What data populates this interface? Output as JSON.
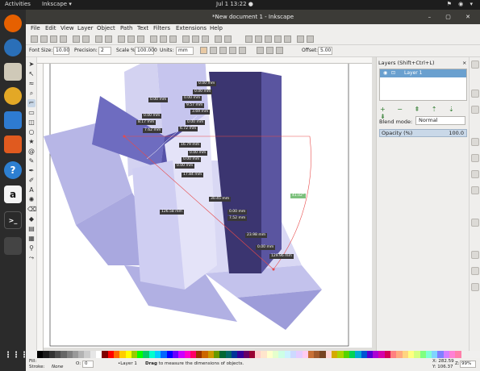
{
  "topbar": {
    "activities": "Activities",
    "app_name": "Inkscape ▾",
    "clock": "Jul 1  13:22 ●",
    "tray": "⚑ ◉ ▾"
  },
  "window": {
    "title": "*New document 1 - Inkscape",
    "controls": "– ▢ ✕"
  },
  "menu": [
    "File",
    "Edit",
    "View",
    "Layer",
    "Object",
    "Path",
    "Text",
    "Filters",
    "Extensions",
    "Help"
  ],
  "controls_bar": {
    "font_size_label": "Font Size:",
    "font_size_value": "10.00",
    "precision_label": "Precision:",
    "precision_value": "2",
    "scale_label": "Scale %:",
    "scale_value": "100.000",
    "units_label": "Units:",
    "units_value": "mm",
    "offset_label": "Offset:",
    "offset_value": "5.00"
  },
  "layers_panel": {
    "title": "Layers (Shift+Ctrl+L)",
    "close": "×",
    "layer_name": "Layer 1",
    "eye": "◉",
    "lock": "⊡",
    "buttons": "+ − ⇞ ⇡ ⇣ ⇟",
    "blend_label": "Blend mode:",
    "blend_value": "Normal",
    "opacity_label": "Opacity (%)",
    "opacity_value": "100.0"
  },
  "measurements": [
    "0.00 mm",
    "0.00 mm",
    "0.00 mm",
    "0.00 mm",
    "9.57 mm",
    "3.69 mm",
    "0.00 mm",
    "8.17 mm",
    "0.00 mm",
    "7.62 mm",
    "6.72 mm",
    "16.79 mm",
    "0.00 mm",
    "0.00 mm",
    "0.00 mm",
    "17.84 mm",
    "30.45 mm",
    "0.00 mm",
    "126.58 mm",
    "7.52 mm",
    "23.98 mm",
    "0.00 mm",
    "129.96 mm"
  ],
  "angle_label": "41.02°",
  "statusbar": {
    "fill_label": "Fill:",
    "stroke_label": "Stroke:",
    "stroke_value": "None",
    "opacity_label": "O:",
    "opacity_value": "0",
    "layer": "•Layer 1",
    "message_bold": "Drag",
    "message": " to measure the dimensions of objects.",
    "x": "X:  282.59",
    "y": "Y:  106.37",
    "zoom_label": "Z:",
    "zoom_value": "99%"
  },
  "colors": {
    "canvas_shape_dark": "#3b3570",
    "canvas_shape_mid": "#6e6cc0",
    "canvas_shape_light": "#b7b6e6",
    "measure_line": "#e84a4a",
    "selection_blue": "#6aa0cf"
  },
  "icons": {
    "dock": [
      "firefox-icon",
      "thunderbird-icon",
      "files-icon",
      "rhythmbox-icon",
      "writer-icon",
      "software-icon",
      "help-icon",
      "amazon-icon",
      "terminal-icon",
      "inkscape-icon",
      "apps-grid-icon"
    ]
  }
}
